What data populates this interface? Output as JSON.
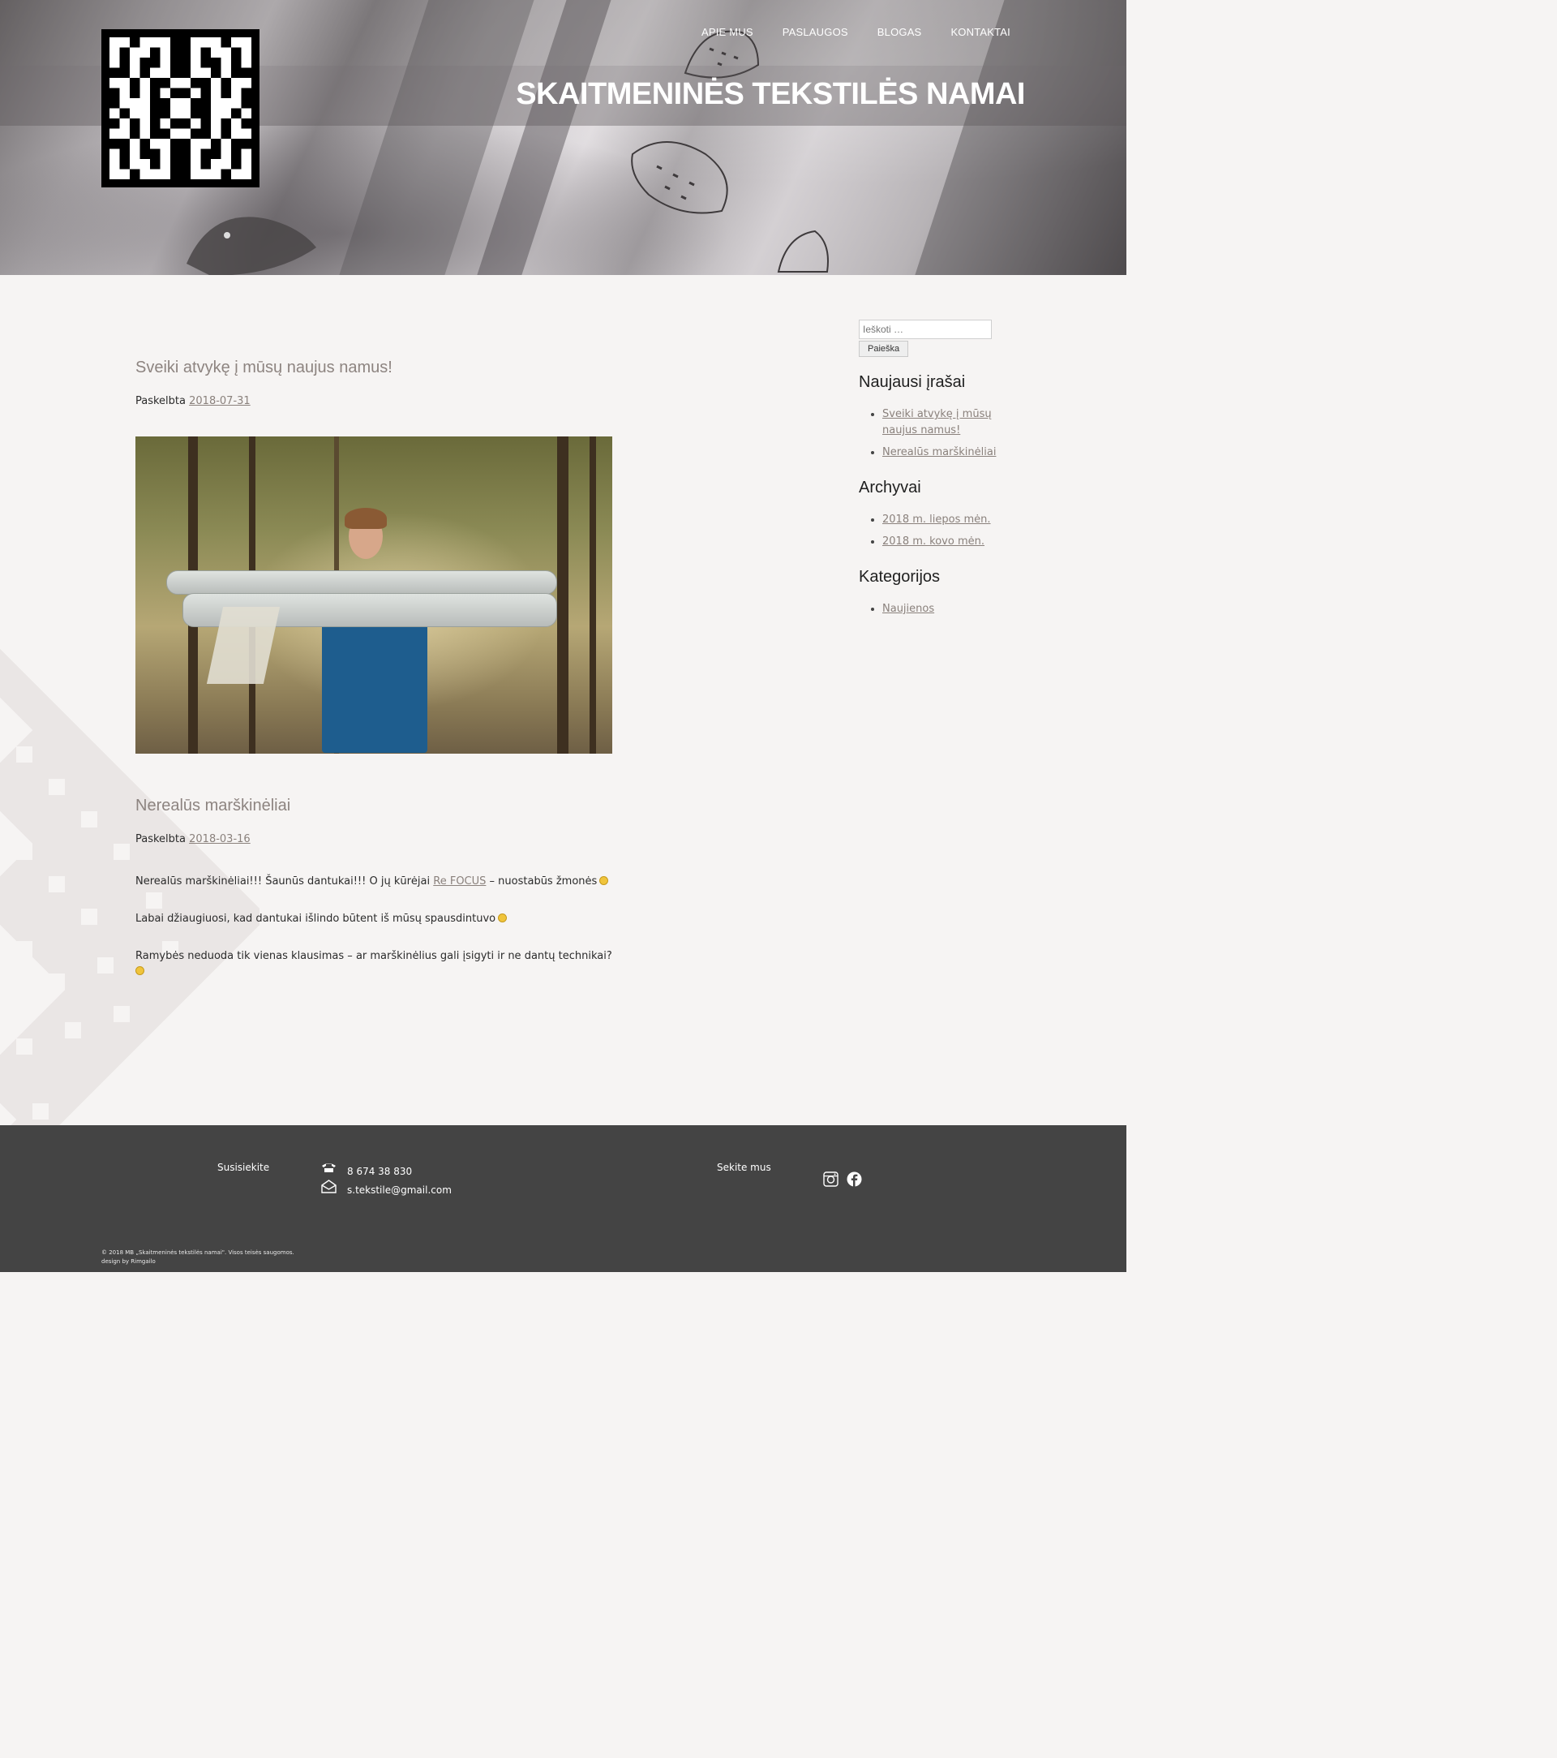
{
  "header": {
    "site_title": "SKAITMENINĖS TEKSTILĖS NAMAI",
    "nav": [
      "APIE MUS",
      "PASLAUGOS",
      "BLOGAS",
      "KONTAKTAI"
    ]
  },
  "posts": [
    {
      "title": "Sveiki atvykę į mūsų naujus namus!",
      "meta_label": "Paskelbta",
      "date": "2018-07-31"
    },
    {
      "title": "Nerealūs marškinėliai",
      "meta_label": "Paskelbta",
      "date": "2018-03-16",
      "p1_a": "Nerealūs marškinėliai!!! Šaunūs dantukai!!! O jų kūrėjai ",
      "p1_link": "Re FOCUS",
      "p1_b": " – nuostabūs žmonės",
      "p2": "Labai džiaugiuosi, kad dantukai išlindo būtent iš mūsų spausdintuvo",
      "p3": "Ramybės neduoda tik vienas klausimas – ar marškinėlius gali įsigyti ir ne dantų technikai?"
    }
  ],
  "sidebar": {
    "search_placeholder": "Ieškoti …",
    "search_button": "Paieška",
    "recent_title": "Naujausi įrašai",
    "recent": [
      "Sveiki atvykę į mūsų naujus namus!",
      "Nerealūs marškinėliai"
    ],
    "archives_title": "Archyvai",
    "archives": [
      "2018 m. liepos mėn.",
      "2018 m. kovo mėn."
    ],
    "categories_title": "Kategorijos",
    "categories": [
      "Naujienos"
    ]
  },
  "footer": {
    "contact_label": "Susisiekite",
    "phone": "8 674 38 830",
    "email": "s.tekstile@gmail.com",
    "follow_label": "Sekite mus",
    "copyright": "© 2018 MB „Skaitmeninės tekstilės namai\". Visos teisės saugomos.",
    "design": "design by Rimgailo"
  }
}
